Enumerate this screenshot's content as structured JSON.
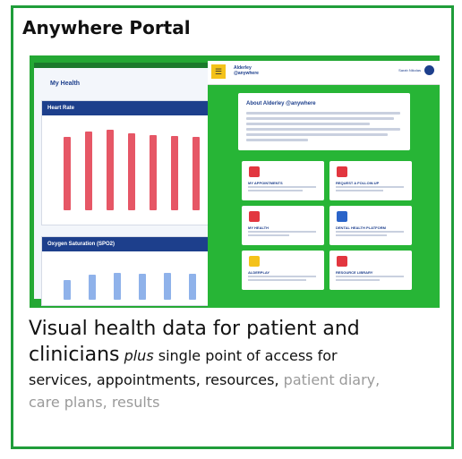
{
  "slide": {
    "title": "Anywhere Portal",
    "caption": {
      "line1": "Visual health data for patient and",
      "line2_big": "clinicians",
      "line2_italic": "plus",
      "line2_rest": "single point of access for",
      "line3_dark": "services, appointments, resources,",
      "line3_grey": "patient diary,",
      "line4_grey": "care plans, results"
    }
  },
  "dashboard": {
    "title": "My Health",
    "heart_rate_title": "Heart Rate",
    "spo2_title": "Oxygen Saturation (SPO2)",
    "heart_rate_bars": [
      0.82,
      0.88,
      0.9,
      0.86,
      0.84,
      0.83,
      0.82
    ],
    "spo2_bars": [
      0.55,
      0.7,
      0.75,
      0.72,
      0.74,
      0.73
    ]
  },
  "portal": {
    "logo": "Alderley @anywhere",
    "user": "Sarah Nikolas",
    "about_title": "About Alderley @anywhere",
    "tiles": [
      {
        "label": "MY APPOINTMENTS",
        "icon": "calendar-icon",
        "color": "#e2363f"
      },
      {
        "label": "REQUEST A FOLLOW-UP",
        "icon": "phone-icon",
        "color": "#e2363f"
      },
      {
        "label": "MY HEALTH",
        "icon": "heart-monitor-icon",
        "color": "#e2363f"
      },
      {
        "label": "DENTAL HEALTH PLATFORM",
        "icon": "tooth-icon",
        "color": "#2a64c9"
      },
      {
        "label": "ALDERPLAY",
        "icon": "gamepad-icon",
        "color": "#f4c21a"
      },
      {
        "label": "RESOURCE LIBRARY",
        "icon": "books-icon",
        "color": "#e2363f"
      }
    ]
  },
  "colors": {
    "brand_green": "#1f9d3a",
    "navy": "#1d3f8c",
    "heart_bar": "#e65766",
    "spo2_bar": "#8fb2ea"
  }
}
